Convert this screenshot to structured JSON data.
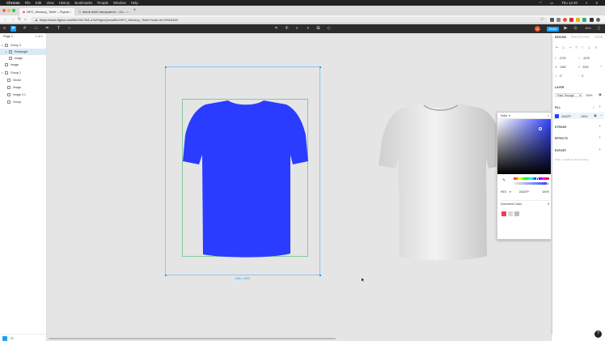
{
  "menubar": {
    "apple": "",
    "app": "Chrome",
    "items": [
      "File",
      "Edit",
      "View",
      "History",
      "Bookmarks",
      "People",
      "Window",
      "Help"
    ],
    "clock": "Thu 12:40"
  },
  "browser": {
    "tabs": [
      {
        "title": "NFO_Mockup_Tshirt – Figma",
        "active": true
      },
      {
        "title": "blank tshirt transparent – Go…",
        "active": false
      }
    ],
    "new_tab": "+",
    "url": "https://www.figma.com/file/04LYN4-oTwFbgkxQzxw85L/NFO_Mockup_Tshirt?node-id=0%3A448"
  },
  "toolbar": {
    "share_label": "Share",
    "zoom_label": "46%",
    "avatar_initial": "A"
  },
  "left_panel": {
    "page_label": "Page 1",
    "page_count": "1 of 1",
    "layers": [
      {
        "name": "Group 3",
        "indent": 0,
        "type": "group",
        "expanded": true
      },
      {
        "name": "Rectangle",
        "indent": 1,
        "type": "rect",
        "selected": true
      },
      {
        "name": "Image",
        "indent": 1,
        "type": "image"
      },
      {
        "name": "Image",
        "indent": 0,
        "type": "image"
      },
      {
        "name": "Group 2",
        "indent": 0,
        "type": "group",
        "expanded": true
      },
      {
        "name": "Vector",
        "indent": 1,
        "type": "vector"
      },
      {
        "name": "Image",
        "indent": 1,
        "type": "image"
      },
      {
        "name": "Image 2.1",
        "indent": 1,
        "type": "image"
      },
      {
        "name": "Group",
        "indent": 1,
        "type": "group"
      }
    ]
  },
  "canvas": {
    "frame_dim_label": "1496 × 2093",
    "shirt_fill": "#2A3CFF"
  },
  "color_picker": {
    "mode": "Solid",
    "format": "HEX",
    "hex": "2A3CFF",
    "opacity": "100%",
    "library": "Document Colors",
    "swatches": [
      "#E8424A",
      "#DADADA",
      "#BDBDBD"
    ]
  },
  "right_panel": {
    "tabs": [
      "DESIGN",
      "PROTOTYPE",
      "CODE"
    ],
    "x": "-3720",
    "y": "-1078",
    "w": "1349",
    "h": "2002",
    "rotation": "0°",
    "radius": "0",
    "layer_title": "LAYER",
    "blend": "Pass Through",
    "layer_opacity": "100%",
    "fill_title": "FILL",
    "fill_hex": "2A3CFF",
    "fill_opacity": "100%",
    "stroke_title": "STROKE",
    "effects_title": "EFFECTS",
    "export_title": "EXPORT",
    "export_note": "Click + to add an export setting"
  }
}
